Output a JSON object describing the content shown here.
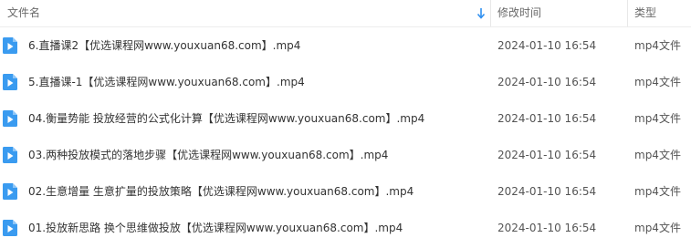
{
  "header": {
    "name_label": "文件名",
    "date_label": "修改时间",
    "type_label": "类型"
  },
  "colors": {
    "accent": "#2e8ff0",
    "icon_blue": "#3a9bf0"
  },
  "files": [
    {
      "icon": "video-file-icon",
      "name": "6.直播课2【优选课程网www.youxuan68.com】.mp4",
      "date": "2024-01-10 16:54",
      "type": "mp4文件"
    },
    {
      "icon": "video-file-icon",
      "name": "5.直播课-1【优选课程网www.youxuan68.com】.mp4",
      "date": "2024-01-10 16:54",
      "type": "mp4文件"
    },
    {
      "icon": "video-file-icon",
      "name": "04.衡量势能 投放经营的公式化计算【优选课程网www.youxuan68.com】.mp4",
      "date": "2024-01-10 16:54",
      "type": "mp4文件"
    },
    {
      "icon": "video-file-icon",
      "name": "03.两种投放模式的落地步骤【优选课程网www.youxuan68.com】.mp4",
      "date": "2024-01-10 16:54",
      "type": "mp4文件"
    },
    {
      "icon": "video-file-icon",
      "name": "02.生意增量 生意扩量的投放策略【优选课程网www.youxuan68.com】.mp4",
      "date": "2024-01-10 16:54",
      "type": "mp4文件"
    },
    {
      "icon": "video-file-icon",
      "name": "01.投放新思路 换个思维做投放【优选课程网www.youxuan68.com】.mp4",
      "date": "2024-01-10 16:54",
      "type": "mp4文件"
    }
  ]
}
